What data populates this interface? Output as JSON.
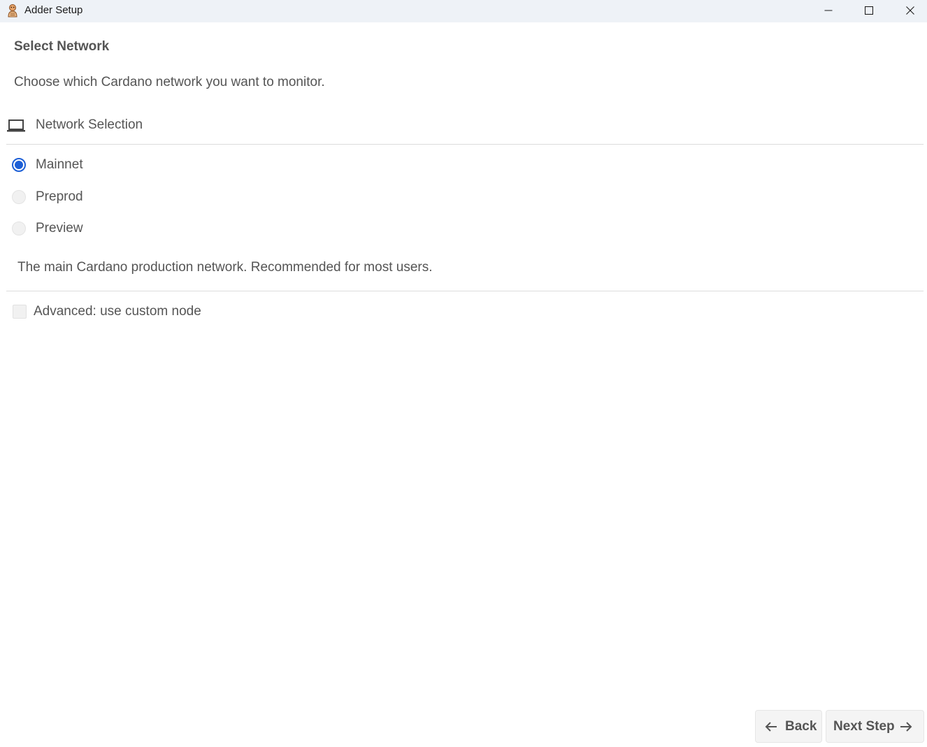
{
  "window": {
    "title": "Adder Setup"
  },
  "page": {
    "title": "Select Network",
    "description": "Choose which Cardano network you want to monitor."
  },
  "section": {
    "label": "Network Selection",
    "icon": "laptop-icon"
  },
  "networks": {
    "selected": "Mainnet",
    "options": [
      {
        "label": "Mainnet",
        "checked": true
      },
      {
        "label": "Preprod",
        "checked": false
      },
      {
        "label": "Preview",
        "checked": false
      }
    ],
    "selected_description": "The main Cardano production network. Recommended for most users."
  },
  "advanced": {
    "label": "Advanced: use custom node",
    "checked": false
  },
  "footer": {
    "back_label": "Back",
    "next_label": "Next Step"
  },
  "colors": {
    "accent": "#1d5fd6",
    "titlebar": "#eef2f7",
    "text": "#555555"
  }
}
